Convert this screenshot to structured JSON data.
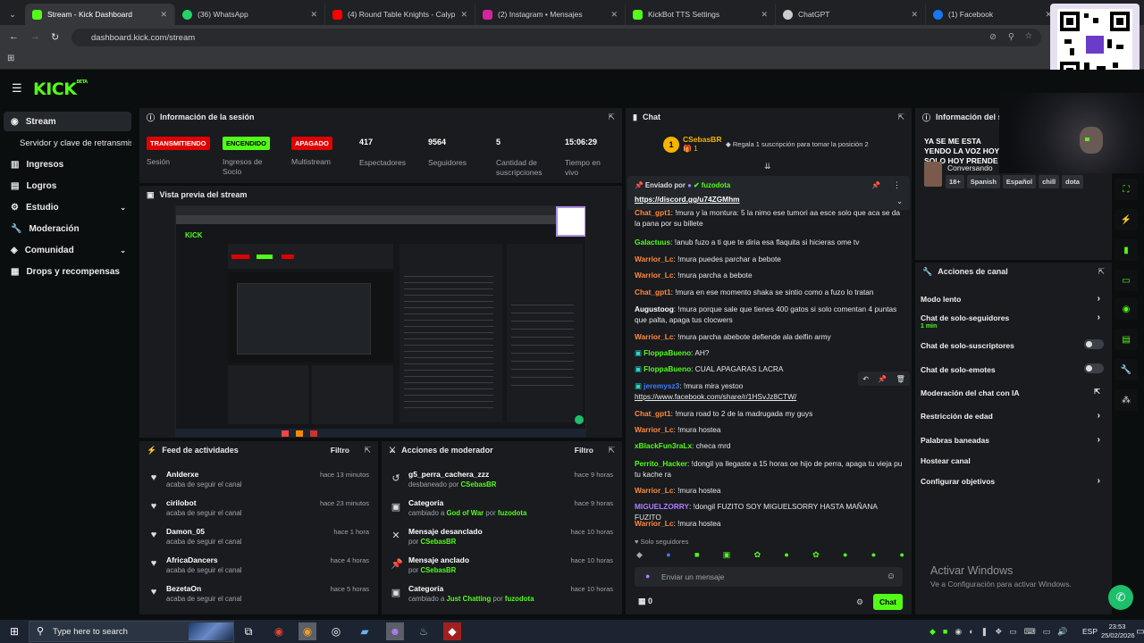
{
  "browser": {
    "tabs": [
      {
        "label": "Stream - Kick Dashboard",
        "color": "#53fc18"
      },
      {
        "label": "(36) WhatsApp",
        "color": "#25d366"
      },
      {
        "label": "(4) Round Table Knights - Calyp",
        "color": "#ff0000"
      },
      {
        "label": "(2) Instagram • Mensajes",
        "color": "#d6249f"
      },
      {
        "label": "KickBot TTS Settings",
        "color": "#53fc18"
      },
      {
        "label": "ChatGPT",
        "color": "#cccccc"
      },
      {
        "label": "(1) Facebook",
        "color": "#1877f2"
      }
    ],
    "url": "dashboard.kick.com/stream"
  },
  "sidebar": {
    "items": [
      {
        "label": "Stream",
        "icon": "broadcast-icon"
      },
      {
        "label": "Servidor y clave de retransmisión"
      },
      {
        "label": "Ingresos",
        "icon": "chart-icon"
      },
      {
        "label": "Logros",
        "icon": "trophy-icon"
      },
      {
        "label": "Estudio",
        "icon": "studio-icon"
      },
      {
        "label": "Moderación",
        "icon": "wrench-icon"
      },
      {
        "label": "Comunidad",
        "icon": "community-icon"
      },
      {
        "label": "Drops y recompensas",
        "icon": "gift-icon"
      }
    ]
  },
  "session": {
    "title": "Información de la sesión",
    "badges": [
      {
        "label": "TRANSMITIENDO",
        "caption": "Sesión",
        "bg": "#e00000",
        "fg": "#ffffff"
      },
      {
        "label": "ENCENDIDO",
        "caption": "Ingresos de Socio",
        "bg": "#53fc18",
        "fg": "#000000"
      },
      {
        "label": "APAGADO",
        "caption": "Multistream",
        "bg": "#e00000",
        "fg": "#ffffff"
      }
    ],
    "stats": [
      {
        "value": "417",
        "label": "Espectadores"
      },
      {
        "value": "9564",
        "label": "Seguidores"
      },
      {
        "value": "5",
        "label": "Cantidad de suscripciones"
      },
      {
        "value": "15:06:29",
        "label": "Tiempo en vivo"
      }
    ]
  },
  "preview": {
    "title": "Vista previa del stream"
  },
  "feed": {
    "title": "Feed de actividades",
    "filter": "Filtro",
    "items": [
      {
        "user": "Anlderxe",
        "action": "acaba de seguir el canal",
        "time": "hace 13 minutos"
      },
      {
        "user": "cirilobot",
        "action": "acaba de seguir el canal",
        "time": "hace 23 minutos"
      },
      {
        "user": "Damon_05",
        "action": "acaba de seguir el canal",
        "time": "hace 1 hora"
      },
      {
        "user": "AfricaDancers",
        "action": "acaba de seguir el canal",
        "time": "hace 4 horas"
      },
      {
        "user": "BezetaOn",
        "action": "acaba de seguir el canal",
        "time": "hace 5 horas"
      }
    ]
  },
  "modactions": {
    "title": "Acciones de moderador",
    "filter": "Filtro",
    "items": [
      {
        "title": "g5_perra_cachera_zzz",
        "pre": "desbaneado por",
        "a": "CSebasBR",
        "mid": "",
        "b": "",
        "time": "hace 9 horas",
        "icon": "unban-icon",
        "glyph": "↺"
      },
      {
        "title": "Categoría",
        "pre": "cambiado a",
        "a": "God of War",
        "mid": "por",
        "b": "fuzodota",
        "time": "hace 9 horas",
        "icon": "category-icon",
        "glyph": "▣"
      },
      {
        "title": "Mensaje desanclado",
        "pre": "por",
        "a": "CSebasBR",
        "mid": "",
        "b": "",
        "time": "hace 10 horas",
        "icon": "unpin-icon",
        "glyph": "✕"
      },
      {
        "title": "Mensaje anclado",
        "pre": "por",
        "a": "CSebasBR",
        "mid": "",
        "b": "",
        "time": "hace 10 horas",
        "icon": "pin-icon",
        "glyph": "📌"
      },
      {
        "title": "Categoría",
        "pre": "cambiado a",
        "a": "Just Chatting",
        "mid": "por",
        "b": "fuzodota",
        "time": "hace 10 horas",
        "icon": "category-icon",
        "glyph": "▣"
      }
    ]
  },
  "chat": {
    "title": "Chat",
    "top_gifter": "CSebasBR",
    "gift_count": "1",
    "gift_text": "Regala 1 suscripción para tomar la posición 2",
    "pinned_label": "Enviado por",
    "pinned_user": "fuzodota",
    "pinned_link": "https://discord.gg/u74ZGMhm",
    "messages": [
      {
        "user": "Chat_gpt1",
        "color": "#ff8a3d",
        "text": ": !mura y la montura: 5 la nimo ese tumori aa esce solo que aca se da la pana por su billete"
      },
      {
        "user": "Galactuus",
        "color": "#53fc18",
        "text": ": !anub fuzo a ti que te diria esa flaquita si hicieras ome tv"
      },
      {
        "user": "Warrior_Lc",
        "color": "#ff8a3d",
        "text": ": !mura puedes parchar a bebote"
      },
      {
        "user": "Warrior_Lc",
        "color": "#ff8a3d",
        "text": ": !mura parcha a bebote"
      },
      {
        "user": "Chat_gpt1",
        "color": "#ff8a3d",
        "text": ": !mura en ese momento shaka se sintio como a fuzo lo tratan"
      },
      {
        "user": "Augustoog",
        "color": "#ffffff",
        "text": ": !mura porque sale que tienes 400 gatos si solo comentan 4 puntas que palta, apaga tus clocwers"
      },
      {
        "user": "Warrior_Lc",
        "color": "#ff8a3d",
        "text": ": !mura parcha abebote defiende ala delfin army"
      },
      {
        "user": "FloppaBueno",
        "color": "#53fc18",
        "text": ": AH?"
      },
      {
        "user": "FloppaBueno",
        "color": "#53fc18",
        "text": ": CUAL APAGARAS LACRA"
      },
      {
        "user": "jeremysz3",
        "color": "#3b7dff",
        "text": ": !mura mira yestoo",
        "link": "https://www.facebook.com/share/r/1HSvJz8CTW/"
      },
      {
        "user": "Chat_gpt1",
        "color": "#ff8a3d",
        "text": ": !mura road to 2 de la madrugada my guys"
      },
      {
        "user": "Warrior_Lc",
        "color": "#ff8a3d",
        "text": ": !mura hostea"
      },
      {
        "user": "xBlackFun3raLx",
        "color": "#53fc18",
        "text": ": checa mrd"
      },
      {
        "user": "Perrito_Hacker",
        "color": "#53fc18",
        "text": ": !dongil ya llegaste a 15 horas oe hijo de perra, apaga tu vieja pu tu kache ra"
      },
      {
        "user": "Warrior_Lc",
        "color": "#ff8a3d",
        "text": ": !mura hostea"
      },
      {
        "user": "MIGUELZORRY",
        "color": "#b07cff",
        "text": ": !dongil FUZITO SOY MIGUELSORRY HASTA MAÑANA FUZITO"
      },
      {
        "user": "Warrior_Lc",
        "color": "#ff8a3d",
        "text": ": !mura hostea"
      }
    ],
    "followers_only": "Solo seguidores",
    "input_placeholder": "Enviar un mensaje",
    "count": "0",
    "send_label": "Chat"
  },
  "stream_info": {
    "title": "Información del stream",
    "stream_title": "YA SE ME ESTA YENDO LA VOZ HOY SOLO HOY PRENDE",
    "category": "Conversando",
    "tags": [
      "18+",
      "Spanish",
      "Español",
      "chill",
      "dota"
    ]
  },
  "channel_actions": {
    "title": "Acciones de canal",
    "items": [
      {
        "label": "Modo lento",
        "kind": "arrow",
        "sub": ""
      },
      {
        "label": "Chat de solo-seguidores",
        "kind": "arrow",
        "sub": "1 min"
      },
      {
        "label": "Chat de solo-suscriptores",
        "kind": "toggle",
        "sub": ""
      },
      {
        "label": "Chat de solo-emotes",
        "kind": "toggle",
        "sub": ""
      },
      {
        "label": "Moderación del chat con IA",
        "kind": "external",
        "sub": ""
      },
      {
        "label": "Restricción de edad",
        "kind": "arrow",
        "sub": ""
      },
      {
        "label": "Palabras baneadas",
        "kind": "arrow",
        "sub": ""
      },
      {
        "label": "Hostear canal",
        "kind": "none",
        "sub": ""
      },
      {
        "label": "Configurar objetivos",
        "kind": "arrow",
        "sub": ""
      }
    ]
  },
  "watermark": {
    "line1": "Activar Windows",
    "line2": "Ve a Configuración para activar Windows."
  },
  "taskbar": {
    "search_placeholder": "Type here to search",
    "lang": "ESP",
    "time": "23:53",
    "date": "25/02/2026"
  },
  "colors": {
    "accent": "#53fc18",
    "panel": "#191b1f",
    "bg": "#0b0e0f"
  }
}
